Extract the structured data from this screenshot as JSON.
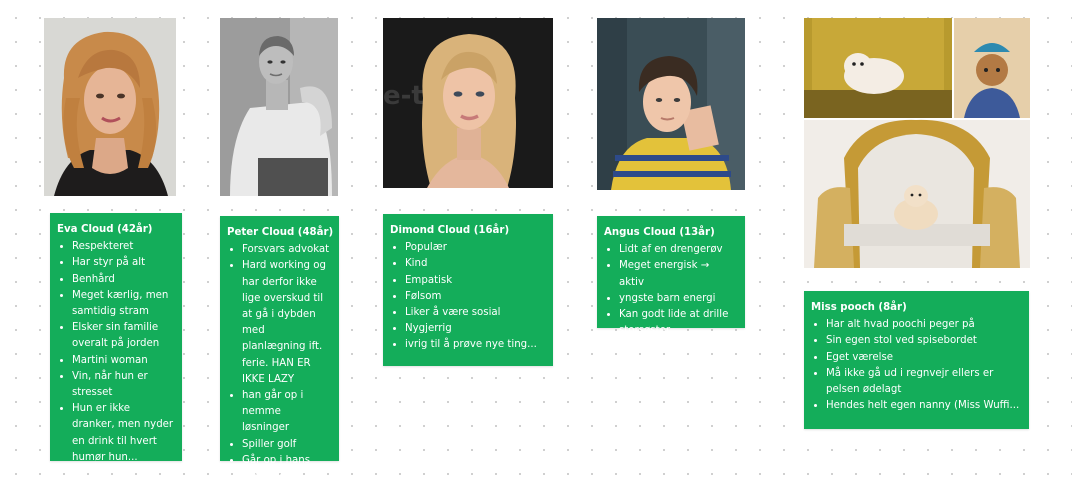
{
  "cards": [
    {
      "title": "Eva Cloud (42år)",
      "items": [
        "Respekteret",
        "Har styr på alt",
        "Benhård",
        "Meget kærlig, men samtidig stram",
        "Elsker sin familie overalt på jorden",
        "Martini woman",
        "Vin, når hun er stresset",
        "Hun er ikke dranker, men nyder en drink til hvert humør hun..."
      ]
    },
    {
      "title": "Peter Cloud (48år)",
      "items": [
        "Forsvars advokat",
        "Hard working og har derfor ikke lige overskud til at gå i dybden med planlægning ift. ferie. HAN ER IKKE LAZY",
        "han går op i nemme løsninger",
        "Spiller golf",
        "Går op i hans udsende..."
      ]
    },
    {
      "title": "Dimond Cloud (16år)",
      "items": [
        "Populær",
        "Kind",
        "Empatisk",
        "Følsom",
        "Liker å være sosial",
        "Nygjerrig",
        "ivrig til å prøve nye ting..."
      ]
    },
    {
      "title": "Angus Cloud (13år)",
      "items": [
        "Lidt af en drengerøv",
        "Meget energisk → aktiv",
        "yngste barn energi",
        "Kan godt lide at drille storsøster"
      ]
    },
    {
      "title": "Miss pooch (8år)",
      "items": [
        "Har alt hvad poochi peger på",
        "Sin egen stol ved spisebordet",
        "Eget værelse",
        "Må ikke gå ud i regnvejr ellers er pelsen ødelagt",
        "Hendes helt egen nanny (Miss Wuffi..."
      ]
    }
  ],
  "photos": [
    "eva-photo",
    "peter-photo",
    "dimond-photo",
    "angus-photo",
    "pooch-photo-collage"
  ],
  "colors": {
    "card_bg": "#14ad5a",
    "card_text": "#ffffff",
    "canvas": "#ffffff",
    "dot": "#c9c9c9"
  }
}
